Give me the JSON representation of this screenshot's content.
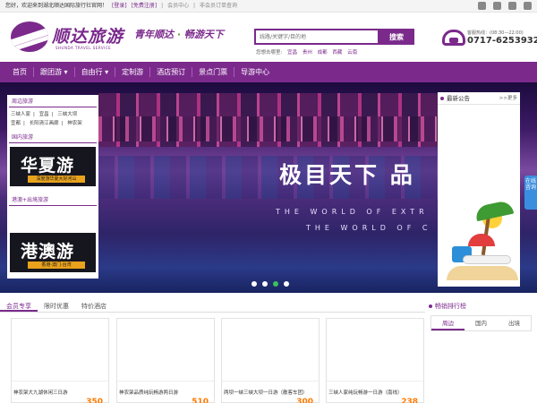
{
  "topbar": {
    "welcome": "您好，欢迎来到湖北顺达国际旅行社官网！",
    "login": "[登录]",
    "register": "[免费注册]",
    "sep": "|",
    "member_center": "会员中心",
    "guest_query": "非会员订单查询"
  },
  "header": {
    "logo_text": "顺达旅游",
    "logo_sub": "SHUNDA TRAVEL SERVICE",
    "slogan_a": "青年顺达",
    "slogan_dot": "·",
    "slogan_b": "畅游天下",
    "search_placeholder": "线路/关键字/目的地",
    "search_button": "搜索",
    "hot_label": "您想去哪里:",
    "hot_places": [
      "宜昌",
      "贵州",
      "成都",
      "西藏",
      "云南"
    ],
    "hotline_label": "客服热线：(08:30—22:00)",
    "hotline_number": "0717-6253932"
  },
  "nav": {
    "items": [
      "首页",
      "跟团游",
      "自由行",
      "定制游",
      "酒店预订",
      "景点门票",
      "导游中心"
    ]
  },
  "banner": {
    "title": "极目天下 品",
    "en_line1": "THE WORLD OF EXTR",
    "en_line2": "THE WORLD OF C",
    "dot_count": 4,
    "active_dot": 2
  },
  "side_left": {
    "section1_title": "周边旅游",
    "section1_links_row1": [
      "三峡人家",
      "宜昌",
      "三峡大坝"
    ],
    "section1_links_row2": [
      "宜都",
      "长阳清江画廊",
      "神农架"
    ],
    "section2_title": "国内旅游",
    "promo1_title": "华夏游",
    "promo1_sub": "深度游华夏大好河山",
    "section3_title": "港澳+出境旅游",
    "promo2_title": "港澳游",
    "promo2_sub": "香港·澳门·台湾"
  },
  "news": {
    "title": "最新公告",
    "more": ">>更多"
  },
  "float_tab": "在线咨询",
  "tabs": [
    "会员专享",
    "限时优惠",
    "特价酒店"
  ],
  "rank": {
    "title": "畅销排行榜",
    "tabs": [
      "周边",
      "国内",
      "出境"
    ]
  },
  "cards": [
    {
      "title": "神农架大九湖休闲三日游",
      "price": "350"
    },
    {
      "title": "神农架品质纯玩畅游两日游",
      "price": "510"
    },
    {
      "title": "两坝一峡三峡大坝一日游（散客车团）",
      "price": "300"
    },
    {
      "title": "三峡人家纯玩畅游一日游（南线）",
      "price": "238"
    }
  ],
  "colors": {
    "brand_purple": "#7b2a8c",
    "price_orange": "#ff7a00",
    "active_dot": "#3cbf5a"
  }
}
